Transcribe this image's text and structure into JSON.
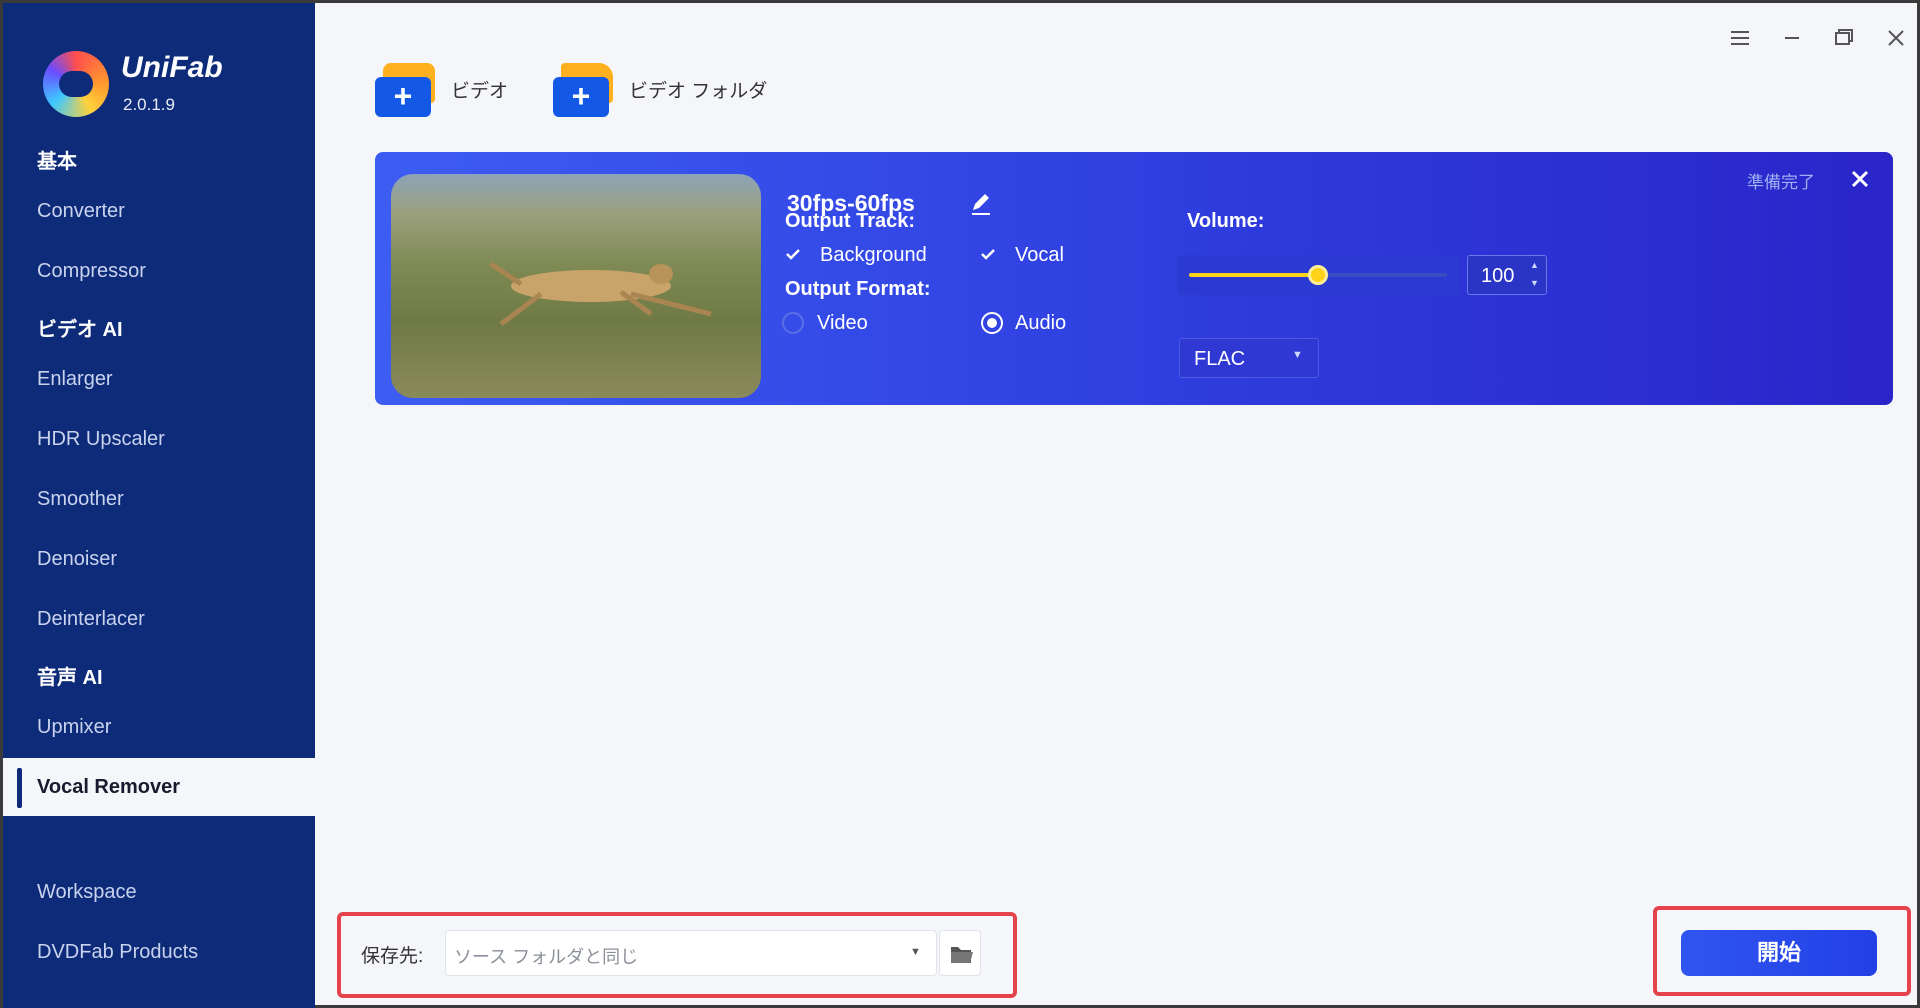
{
  "app": {
    "name": "UniFab",
    "version": "2.0.1.9"
  },
  "sidebar": {
    "sections": [
      {
        "label": "基本",
        "items": [
          {
            "label": "Converter"
          },
          {
            "label": "Compressor"
          }
        ]
      },
      {
        "label": "ビデオ AI",
        "items": [
          {
            "label": "Enlarger"
          },
          {
            "label": "HDR Upscaler"
          },
          {
            "label": "Smoother"
          },
          {
            "label": "Denoiser"
          },
          {
            "label": "Deinterlacer"
          }
        ]
      },
      {
        "label": "音声 AI",
        "items": [
          {
            "label": "Upmixer"
          },
          {
            "label": "Vocal Remover"
          }
        ]
      }
    ],
    "active_item": "Vocal Remover",
    "footer_items": [
      {
        "label": "Workspace"
      },
      {
        "label": "DVDFab Products"
      }
    ]
  },
  "window_controls": {
    "menu": "menu-icon",
    "minimize": "minimize-icon",
    "restore": "restore-icon",
    "close": "close-icon"
  },
  "toolbar": {
    "add_video_label": "ビデオ",
    "add_folder_label": "ビデオ フォルダ"
  },
  "task": {
    "preset_title": "30fps-60fps",
    "status": "準備完了",
    "output_track_label": "Output Track:",
    "tracks": [
      {
        "label": "Background",
        "checked": true
      },
      {
        "label": "Vocal",
        "checked": true
      }
    ],
    "volume_label": "Volume:",
    "volume_value": "100",
    "volume_level_percent": 50,
    "output_format_label": "Output Format:",
    "formats": [
      {
        "label": "Video",
        "selected": false
      },
      {
        "label": "Audio",
        "selected": true
      }
    ],
    "audio_format": "FLAC"
  },
  "bottom": {
    "save_label": "保存先:",
    "save_path": "ソース フォルダと同じ",
    "start_label": "開始"
  },
  "colors": {
    "sidebar_bg": "#0d2b79",
    "card_start": "#3d5df2",
    "card_end": "#2a25c9",
    "accent_yellow": "#ffd21a",
    "highlight_red": "#e5434b",
    "start_button": "#2f55f0"
  }
}
